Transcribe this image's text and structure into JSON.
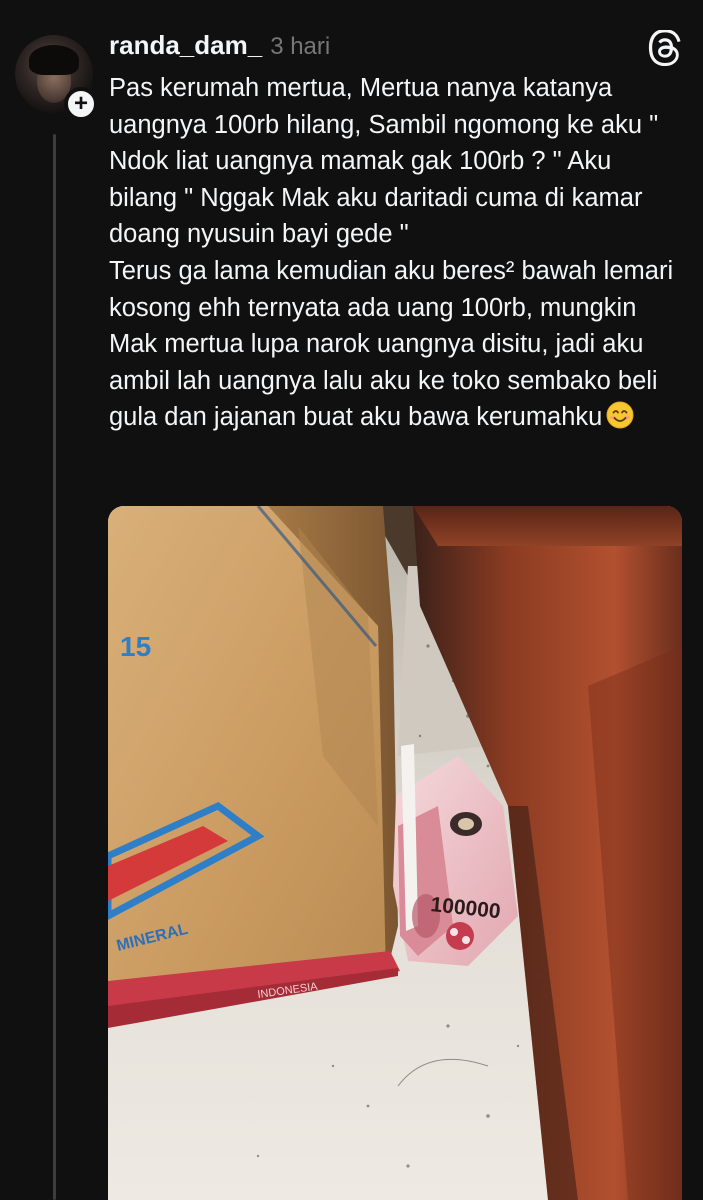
{
  "post": {
    "username": "randa_dam_",
    "time": "3 hari",
    "paragraphs": [
      "Pas kerumah mertua, Mertua nanya katanya uangnya 100rb hilang, Sambil ngomong ke aku \" Ndok liat uangnya mamak gak 100rb ? \" Aku bilang \" Nggak Mak aku daritadi cuma di kamar doang nyusuin bayi gede \"",
      "Terus ga lama kemudian aku beres² bawah lemari kosong ehh ternyata ada uang 100rb, mungkin Mak mertua lupa narok uangnya disitu, jadi aku ambil lah uangnya lalu aku ke toko sembako beli gula dan jajanan buat aku bawa kerumahku"
    ],
    "emoji": "smiling-face-emoji",
    "photo": {
      "box_print_top": "15",
      "box_print_side": "MINERAL",
      "box_print_bottom": "INDONESIA",
      "banknote_print": "100000"
    }
  },
  "icons": {
    "follow": "plus-icon",
    "app": "threads-logo-icon"
  },
  "colors": {
    "background": "#101010",
    "text": "#f3f5f7",
    "muted": "#777777",
    "thread_line": "#3d3d3d"
  }
}
